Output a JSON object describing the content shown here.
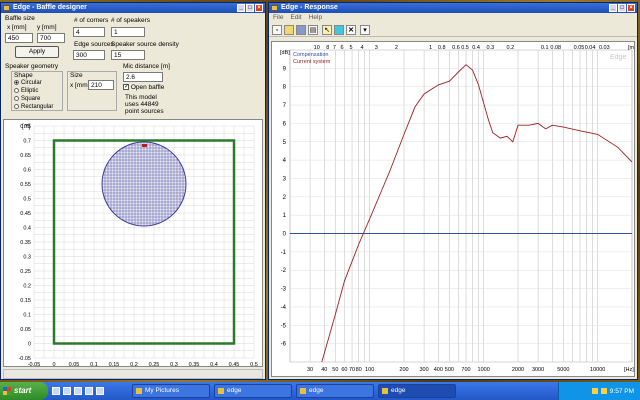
{
  "baffle_window": {
    "title": "Edge - Baffle designer",
    "baffle_size_label": "Baffle size",
    "x_label": "x [mm]",
    "y_label": "y [mm]",
    "x_value": "450",
    "y_value": "700",
    "corners_label": "# of corners",
    "corners_value": "4",
    "speakers_label": "# of speakers",
    "speakers_value": "1",
    "apply_label": "Apply",
    "edge_sources_label": "Edge sources",
    "edge_sources_value": "300",
    "density_label": "Speaker source density",
    "density_value": "15",
    "geometry_label": "Speaker geometry",
    "shape_label": "Shape",
    "shape_options": [
      "Circular",
      "Elliptic",
      "Square",
      "Rectangular"
    ],
    "shape_selected": "Circular",
    "size_label": "Size",
    "size_x_label": "x [mm]",
    "size_value": "210",
    "mic_label": "Mic distance [m]",
    "mic_value": "2.6",
    "open_baffle_label": "Open baffle",
    "open_baffle_checked": true,
    "note": "This model uses 44849 point sources",
    "plot": {
      "y_unit": "[m]",
      "y_ticks": [
        "0.75",
        "0.7",
        "0.65",
        "0.6",
        "0.55",
        "0.5",
        "0.45",
        "0.4",
        "0.35",
        "0.3",
        "0.25",
        "0.2",
        "0.15",
        "0.1",
        "0.05",
        "0",
        "-0.05"
      ],
      "x_ticks": [
        "-0.05",
        "0",
        "0.05",
        "0.1",
        "0.15",
        "0.2",
        "0.25",
        "0.3",
        "0.35",
        "0.4",
        "0.45",
        "0.5"
      ],
      "baffle_color": "#2a7a2a",
      "speaker_color": "#3a3aa0"
    }
  },
  "response_window": {
    "title": "Edge - Response",
    "menu": [
      "File",
      "Edit",
      "Help"
    ],
    "toolbar_icons": [
      "new-icon",
      "open-icon",
      "save-icon",
      "print-icon",
      "cursor-icon",
      "color-icon",
      "close-icon",
      "settings-icon"
    ],
    "watermark": "Edge",
    "legend": [
      {
        "name": "Compensation",
        "color": "#3050a0"
      },
      {
        "name": "Current system",
        "color": "#a02020"
      }
    ],
    "top_unit": "[m]",
    "top_ticks": [
      "10",
      "8",
      "7",
      "6",
      "5",
      "4",
      "3",
      "2",
      "1",
      "0.8",
      "0.6",
      "0.5",
      "0.4",
      "0.3",
      "0.2",
      "0.1",
      "0.08",
      "0.05",
      "0.04",
      "0.03"
    ],
    "y_unit": "[dB]",
    "bottom_unit": "[Hz]",
    "chart_data": {
      "type": "line",
      "xlabel": "",
      "ylabel": "",
      "x_scale": "log",
      "xlim": [
        20,
        20000
      ],
      "ylim": [
        -7,
        10
      ],
      "y_ticks": [
        9,
        8,
        7,
        6,
        5,
        4,
        3,
        2,
        1,
        0,
        -1,
        -2,
        -3,
        -4,
        -5,
        -6
      ],
      "x_ticks": [
        30,
        40,
        50,
        60,
        70,
        80,
        100,
        200,
        300,
        400,
        500,
        700,
        1000,
        2000,
        3000,
        5000,
        10000
      ],
      "series": [
        {
          "name": "Compensation",
          "values": [
            [
              20,
              0
            ],
            [
              20000,
              0
            ]
          ]
        },
        {
          "name": "Current system",
          "values": [
            [
              38,
              -7
            ],
            [
              50,
              -4.4
            ],
            [
              60,
              -2.6
            ],
            [
              80,
              -0.6
            ],
            [
              100,
              0.8
            ],
            [
              150,
              3.4
            ],
            [
              200,
              5.4
            ],
            [
              250,
              6.9
            ],
            [
              300,
              7.6
            ],
            [
              400,
              8.1
            ],
            [
              500,
              8.3
            ],
            [
              600,
              8.8
            ],
            [
              700,
              9.2
            ],
            [
              800,
              8.9
            ],
            [
              900,
              8.1
            ],
            [
              1000,
              7.1
            ],
            [
              1100,
              6.2
            ],
            [
              1200,
              5.5
            ],
            [
              1400,
              5.2
            ],
            [
              1600,
              5.3
            ],
            [
              1800,
              5.0
            ],
            [
              2000,
              5.9
            ],
            [
              2500,
              5.9
            ],
            [
              3000,
              6.0
            ],
            [
              3500,
              5.7
            ],
            [
              4000,
              5.9
            ],
            [
              5000,
              5.8
            ],
            [
              7000,
              5.6
            ],
            [
              10000,
              5.4
            ],
            [
              15000,
              4.7
            ],
            [
              20000,
              3.9
            ]
          ]
        }
      ]
    }
  },
  "taskbar": {
    "start_label": "start",
    "tasks": [
      "My Pictures",
      "edge",
      "edge",
      "edge"
    ],
    "active_task": 3,
    "clock": "9:57 PM"
  }
}
